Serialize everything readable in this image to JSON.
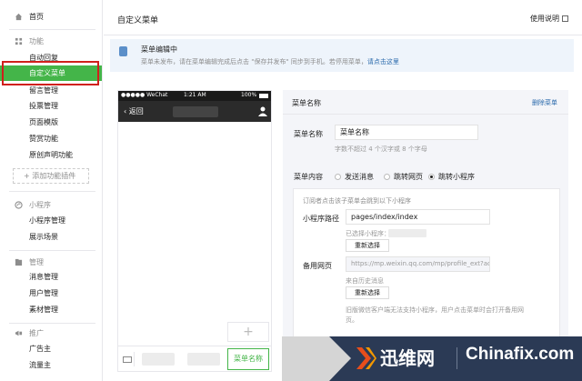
{
  "sidebar": {
    "home": "首页",
    "features_section": "功能",
    "features": [
      "自动回复",
      "自定义菜单",
      "留言管理",
      "投票管理",
      "页面模版",
      "赞赏功能",
      "原创声明功能"
    ],
    "add_plugin": "+ 添加功能插件",
    "miniprogram_section": "小程序",
    "miniprogram": [
      "小程序管理",
      "展示场景"
    ],
    "manage_section": "管理",
    "manage": [
      "消息管理",
      "用户管理",
      "素材管理"
    ],
    "promo_section": "推广",
    "promo": [
      "广告主",
      "流量主"
    ]
  },
  "header": {
    "title": "自定义菜单",
    "help": "使用说明"
  },
  "notice": {
    "title": "菜单编辑中",
    "body": "菜单未发布，请在菜单编辑完成后点击 \"保存并发布\" 同步到手机。若停用菜单，",
    "link": "请点击这里"
  },
  "phone": {
    "carrier": "●●●●● WeChat",
    "time": "1:21 AM",
    "battery": "100%",
    "back": "返回",
    "add": "+",
    "active_tab": "菜单名称"
  },
  "editor": {
    "title": "菜单名称",
    "delete": "删除菜单",
    "name_label": "菜单名称",
    "name_value": "菜单名称",
    "name_hint": "字数不超过 4 个汉字或 8 个字母",
    "content_label": "菜单内容",
    "options": [
      "发送消息",
      "跳转网页",
      "跳转小程序"
    ],
    "selected_option": "跳转小程序",
    "sub_intro": "订阅者点击该子菜单会跳到以下小程序",
    "path_label": "小程序路径",
    "path_value": "pages/index/index",
    "selected_mp": "已选择小程序：",
    "reselect": "重新选择",
    "backup_label": "备用网页",
    "backup_value": "https://mp.weixin.qq.com/mp/profile_ext?ac",
    "backup_source": "来自历史消息",
    "reselect2": "重新选择",
    "footnote_1": "旧版微信客户端无法支持小程序，用户点击菜单时会打开备用网",
    "footnote_2": "页。"
  },
  "watermark": {
    "name": "迅维网",
    "site": "Chinafix.com"
  },
  "colors": {
    "accent": "#44b549",
    "highlight_border": "#d0201b",
    "link": "#2b6aac",
    "phone_bar": "#2b2b2b"
  }
}
